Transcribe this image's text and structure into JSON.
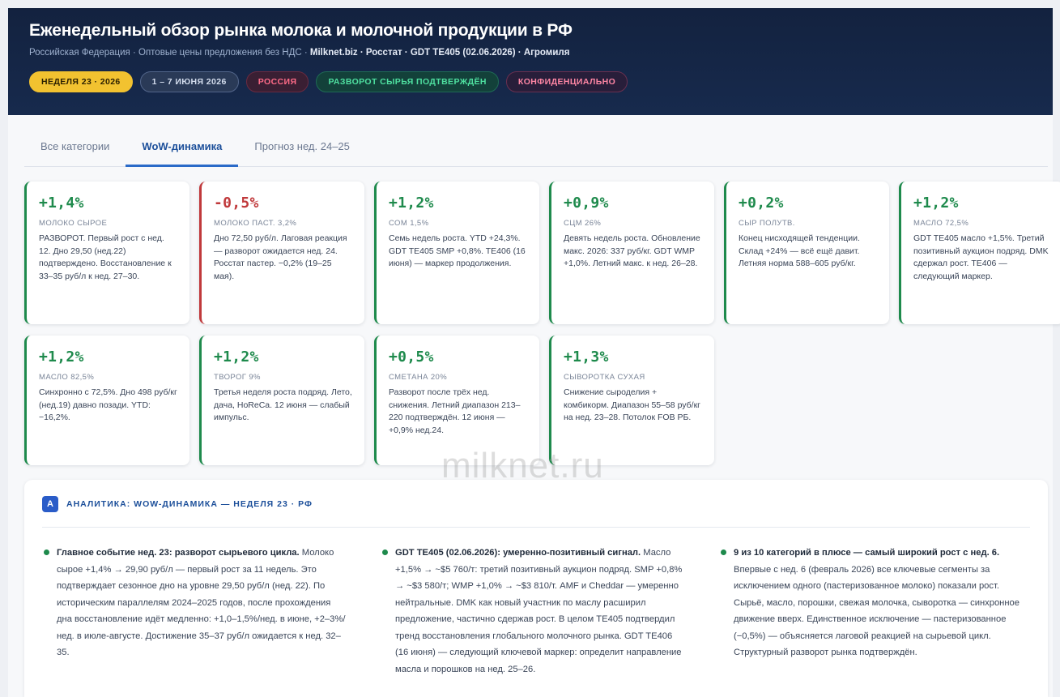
{
  "header": {
    "title": "Еженедельный обзор рынка молока и молочной продукции в РФ",
    "subtitle_plain": "Российская Федерация · Оптовые цены предложения без НДС · ",
    "subtitle_bold": "Milknet.biz · Росстат · GDT TE405 (02.06.2026) · Агромиля",
    "badges": [
      "НЕДЕЛЯ 23 · 2026",
      "1 – 7 ИЮНЯ 2026",
      "РОССИЯ",
      "РАЗВОРОТ СЫРЬЯ ПОДТВЕРЖДЁН",
      "КОНФИДЕНЦИАЛЬНО"
    ]
  },
  "tabs": [
    "Все категории",
    "WoW-динамика",
    "Прогноз нед. 24–25"
  ],
  "active_tab": "WoW-динамика",
  "colors": {
    "positive": "#1e8a4c",
    "negative": "#c0393b",
    "accent": "#2a6ac8"
  },
  "cards": [
    {
      "value": "+1,4%",
      "category": "МОЛОКО СЫРОЕ",
      "trend": "up",
      "text": "РАЗВОРОТ. Первый рост с нед. 12. Дно 29,50 (нед.22) подтверждено. Восстановление к 33–35 руб/л к нед. 27–30."
    },
    {
      "value": "-0,5%",
      "category": "МОЛОКО ПАСТ. 3,2%",
      "trend": "down",
      "text": "Дно 72,50 руб/л. Лаговая реакция — разворот ожидается нед. 24. Росстат пастер. −0,2% (19–25 мая)."
    },
    {
      "value": "+1,2%",
      "category": "СОМ 1,5%",
      "trend": "up",
      "text": "Семь недель роста. YTD +24,3%. GDT TE405 SMP +0,8%. TE406 (16 июня) — маркер продолжения."
    },
    {
      "value": "+0,9%",
      "category": "СЦМ 26%",
      "trend": "up",
      "text": "Девять недель роста. Обновление макс. 2026: 337 руб/кг. GDT WMP +1,0%. Летний макс. к нед. 26–28."
    },
    {
      "value": "+0,2%",
      "category": "СЫР ПОЛУТВ.",
      "trend": "up",
      "text": "Конец нисходящей тенденции. Склад +24% — всё ещё давит. Летняя норма 588–605 руб/кг."
    },
    {
      "value": "+1,2%",
      "category": "МАСЛО 72,5%",
      "trend": "up",
      "text": "GDT TE405 масло +1,5%. Третий позитивный аукцион подряд. DMK сдержал рост. TE406 — следующий маркер."
    },
    {
      "value": "+1,2%",
      "category": "МАСЛО 82,5%",
      "trend": "up",
      "text": "Синхронно с 72,5%. Дно 498 руб/кг (нед.19) давно позади. YTD: −16,2%."
    },
    {
      "value": "+1,2%",
      "category": "ТВОРОГ 9%",
      "trend": "up",
      "text": "Третья неделя роста подряд. Лето, дача, HoReCa. 12 июня — слабый импульс."
    },
    {
      "value": "+0,5%",
      "category": "СМЕТАНА 20%",
      "trend": "up",
      "text": "Разворот после трёх нед. снижения. Летний диапазон 213–220 подтверждён. 12 июня — +0,9% нед.24."
    },
    {
      "value": "+1,3%",
      "category": "СЫВОРОТКА СУХАЯ",
      "trend": "up",
      "text": "Снижение сыроделия + комбикорм. Диапазон 55–58 руб/кг на нед. 23–28. Потолок FOB РБ."
    }
  ],
  "watermark": "milknet.ru",
  "analytics": {
    "badge": "A",
    "title": "АНАЛИТИКА: WOW-ДИНАМИКА — НЕДЕЛЯ 23 · РФ",
    "columns": [
      {
        "heading": "Главное событие нед. 23: разворот сырьевого цикла.",
        "body": " Молоко сырое +1,4% → 29,90 руб/л — первый рост за 11 недель. Это подтверждает сезонное дно на уровне 29,50 руб/л (нед. 22). По историческим параллелям 2024–2025 годов, после прохождения дна восстановление идёт медленно: +1,0–1,5%/нед. в июне, +2–3%/нед. в июле-августе. Достижение 35–37 руб/л ожидается к нед. 32–35."
      },
      {
        "heading": "GDT TE405 (02.06.2026): умеренно-позитивный сигнал.",
        "body": " Масло +1,5% → ~$5 760/т: третий позитивный аукцион подряд. SMP +0,8% → ~$3 580/т; WMP +1,0% → ~$3 810/т. AMF и Cheddar — умеренно нейтральные. DMK как новый участник по маслу расширил предложение, частично сдержав рост. В целом TE405 подтвердил тренд восстановления глобального молочного рынка. GDT TE406 (16 июня) — следующий ключевой маркер: определит направление масла и порошков на нед. 25–26."
      },
      {
        "heading": "9 из 10 категорий в плюсе — самый широкий рост с нед. 6.",
        "body": " Впервые с нед. 6 (февраль 2026) все ключевые сегменты за исключением одного (пастеризованное молоко) показали рост. Сырьё, масло, порошки, свежая молочка, сыворотка — синхронное движение вверх. Единственное исключение — пастеризованное (−0,5%) — объясняется лаговой реакцией на сырьевой цикл. Структурный разворот рынка подтверждён."
      }
    ]
  }
}
